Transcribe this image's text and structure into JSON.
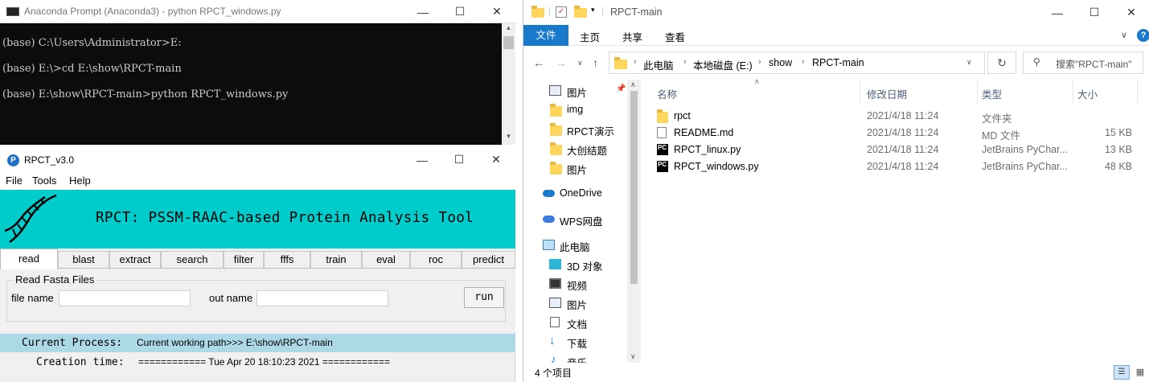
{
  "console": {
    "title": "Anaconda Prompt (Anaconda3) - python  RPCT_windows.py",
    "lines": [
      "(base) C:\\Users\\Administrator>E:",
      "(base) E:\\>cd E:\\show\\RPCT-main",
      "(base) E:\\show\\RPCT-main>python RPCT_windows.py"
    ]
  },
  "rpct": {
    "title": "RPCT_v3.0",
    "menu": [
      "File",
      "Tools",
      "Help"
    ],
    "banner_title": "RPCT: PSSM-RAAC-based Protein Analysis Tool",
    "tabs": [
      "read",
      "blast",
      "extract",
      "search",
      "filter",
      "fffs",
      "train",
      "eval",
      "roc",
      "predict"
    ],
    "active_tab": "read",
    "group_title": "Read Fasta Files",
    "file_name_label": "file name",
    "out_name_label": "out name",
    "file_name_value": "",
    "out_name_value": "",
    "run_label": "run",
    "status_label": "Current Process:",
    "status_value": "Current working path>>> E:\\show\\RPCT-main",
    "time_label": "Creation time:",
    "time_value": "============ Tue Apr 20 18:10:23 2021 ============",
    "banner_color": "#00cccc",
    "status_color": "#add8e6"
  },
  "explorer": {
    "title": "RPCT-main",
    "ribbon": {
      "file": "文件",
      "tabs": [
        "主页",
        "共享",
        "查看"
      ]
    },
    "breadcrumb": [
      "此电脑",
      "本地磁盘 (E:)",
      "show",
      "RPCT-main"
    ],
    "search_placeholder": "搜索\"RPCT-main\"",
    "nav_items": [
      {
        "label": "图片",
        "icon": "pictures-icon",
        "pinned": true
      },
      {
        "label": "img",
        "icon": "folder-icon"
      },
      {
        "label": "RPCT演示",
        "icon": "folder-icon"
      },
      {
        "label": "大创结题",
        "icon": "folder-icon"
      },
      {
        "label": "图片",
        "icon": "folder-icon"
      },
      {
        "label": "OneDrive",
        "icon": "onedrive-icon"
      },
      {
        "label": "WPS网盘",
        "icon": "wps-cloud-icon"
      },
      {
        "label": "此电脑",
        "icon": "this-pc-icon"
      },
      {
        "label": "3D 对象",
        "icon": "3d-objects-icon"
      },
      {
        "label": "视频",
        "icon": "videos-icon"
      },
      {
        "label": "图片",
        "icon": "pictures-icon"
      },
      {
        "label": "文档",
        "icon": "documents-icon"
      },
      {
        "label": "下载",
        "icon": "downloads-icon"
      },
      {
        "label": "音乐",
        "icon": "music-icon"
      }
    ],
    "columns": [
      "名称",
      "修改日期",
      "类型",
      "大小"
    ],
    "files": [
      {
        "name": "rpct",
        "date": "2021/4/18 11:24",
        "type": "文件夹",
        "size": "",
        "icon": "folder-icon"
      },
      {
        "name": "README.md",
        "date": "2021/4/18 11:24",
        "type": "MD 文件",
        "size": "15 KB",
        "icon": "document-icon"
      },
      {
        "name": "RPCT_linux.py",
        "date": "2021/4/18 11:24",
        "type": "JetBrains PyChar...",
        "size": "13 KB",
        "icon": "pycharm-file-icon"
      },
      {
        "name": "RPCT_windows.py",
        "date": "2021/4/18 11:24",
        "type": "JetBrains PyChar...",
        "size": "48 KB",
        "icon": "pycharm-file-icon"
      }
    ],
    "status": "4 个项目",
    "accent": "#1979ca"
  }
}
